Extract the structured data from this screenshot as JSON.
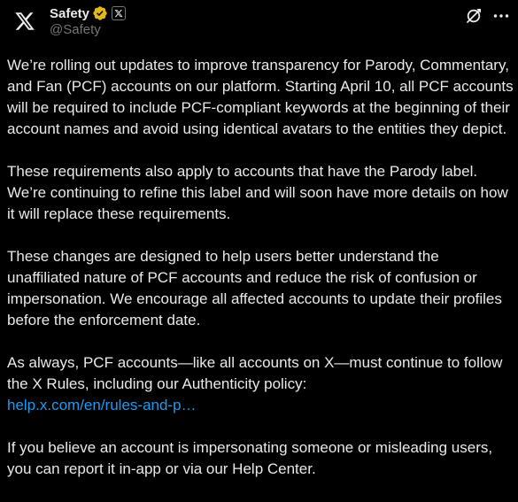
{
  "author": {
    "display_name": "Safety",
    "handle": "@Safety",
    "verified_color": "#e2b719",
    "avatar_icon": "x-logo-icon",
    "affiliate_icon": "x-logo-icon"
  },
  "actions": {
    "grok_icon": "grok-icon",
    "more_icon": "more-dots-icon"
  },
  "post": {
    "paragraphs": [
      "We’re rolling out updates to improve transparency for Parody, Commentary, and Fan (PCF) accounts on our platform. Starting April 10, all PCF accounts will be required to include PCF-compliant keywords at the beginning of their account names and avoid using identical avatars to the entities they depict.",
      "These requirements also apply to accounts that have the Parody label. We’re continuing to refine this label and will soon have more details on how it will replace these requirements.",
      "These changes are designed to help users better understand the unaffiliated nature of PCF accounts and reduce the risk of confusion or impersonation. We encourage all affected accounts to update their profiles before the enforcement date."
    ],
    "paragraph4_text": "As always, PCF accounts—like all accounts on X—must continue to follow the X Rules, including our Authenticity policy:",
    "link_text": "help.x.com/en/rules-and-p…",
    "paragraph5": "If you believe an account is impersonating someone or misleading users, you can report it in-app or via our Help Center."
  },
  "colors": {
    "background": "#000000",
    "text": "#e7e9ea",
    "secondary": "#71767b",
    "link": "#1d9bf0"
  }
}
